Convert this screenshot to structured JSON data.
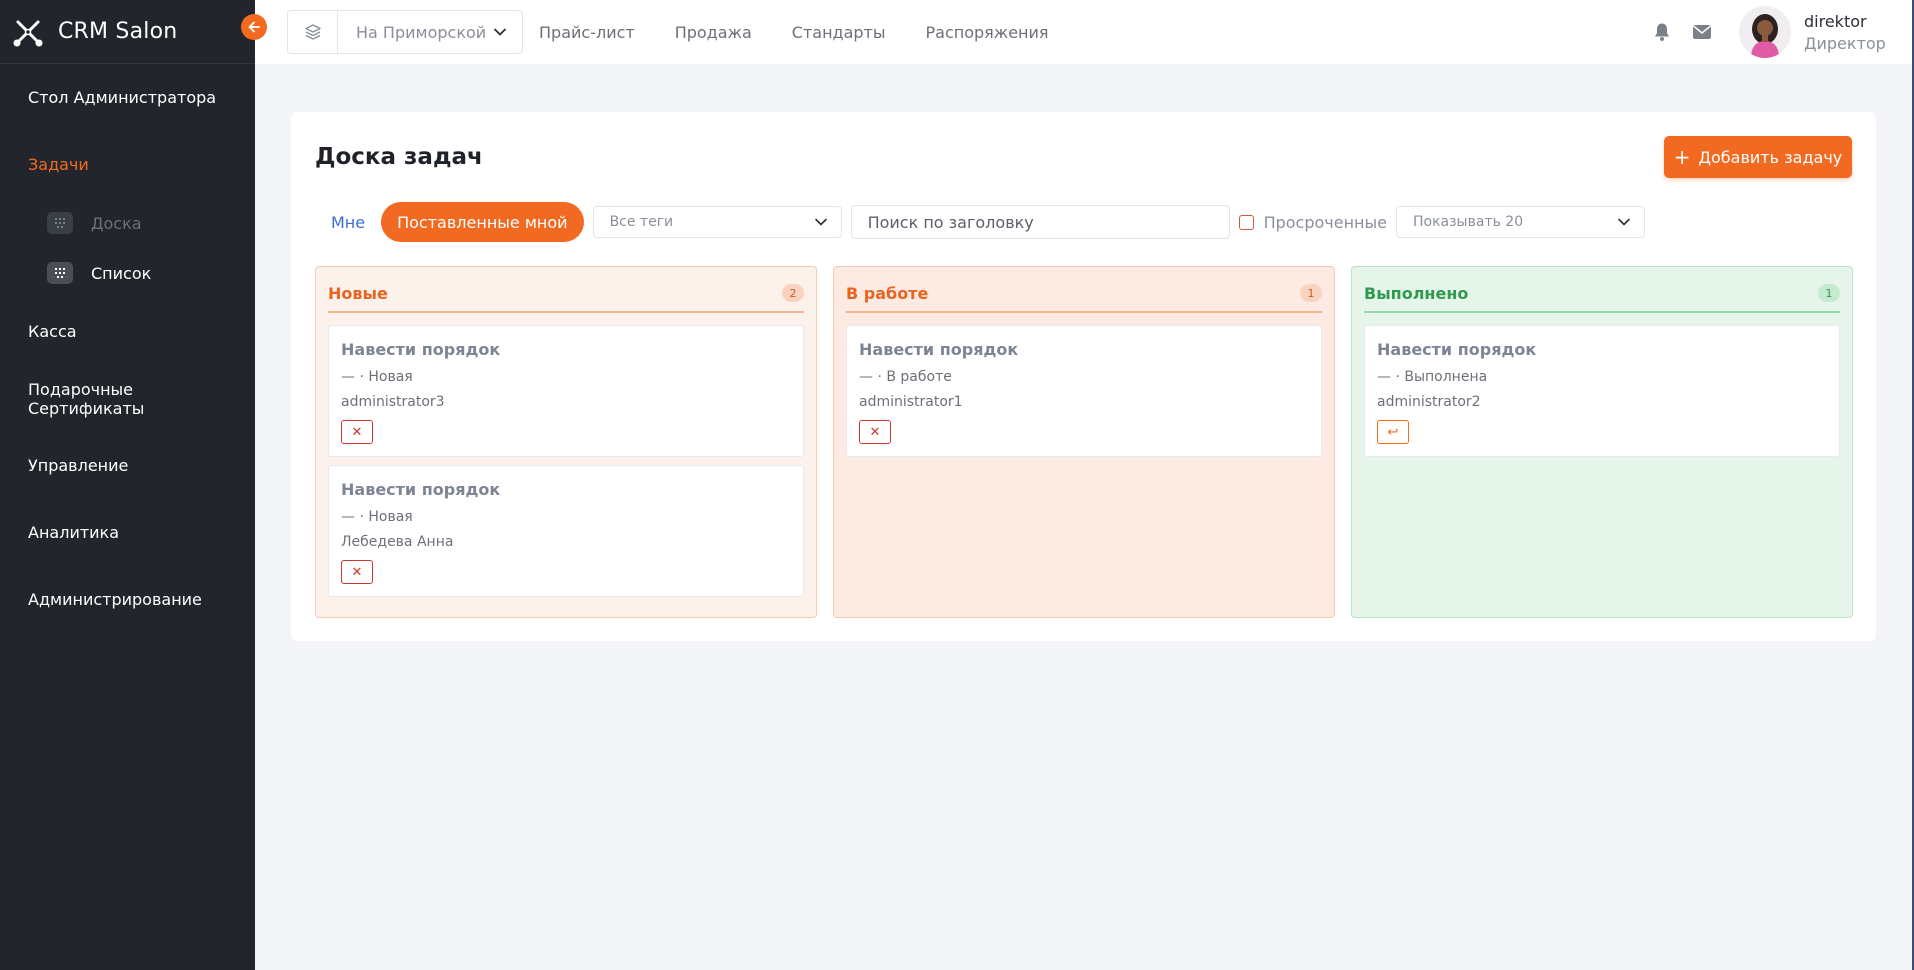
{
  "app": {
    "brand": "CRM Salon",
    "accent": "#f26a21"
  },
  "sidebar": {
    "items": [
      {
        "label": "Стол Администратора"
      },
      {
        "label": "Задачи",
        "active": true
      },
      {
        "label": "Касса"
      },
      {
        "label": "Подарочные Сертификаты"
      },
      {
        "label": "Управление"
      },
      {
        "label": "Аналитика"
      },
      {
        "label": "Администрирование"
      }
    ],
    "tasks_sub": [
      {
        "label": "Доска",
        "icon": "grid-icon"
      },
      {
        "label": "Список",
        "icon": "grid-icon"
      }
    ]
  },
  "topbar": {
    "branch": "На Приморской",
    "links": [
      "Прайс-лист",
      "Продажа",
      "Стандарты",
      "Распоряжения"
    ],
    "user": {
      "name": "direktor",
      "role": "Директор"
    }
  },
  "board": {
    "title": "Доска задач",
    "add_label": "Добавить задачу",
    "filters": {
      "mine": "Мне",
      "assigned_by_me": "Поставленные мной",
      "tags": "Все теги",
      "search_placeholder": "Поиск по заголовку",
      "overdue": "Просроченные",
      "page_size": "Показывать 20"
    },
    "columns": [
      {
        "title": "Новые",
        "count": "2",
        "tasks": [
          {
            "title": "Навести порядок",
            "status": "— · Новая",
            "user": "administrator3",
            "action": "✕"
          },
          {
            "title": "Навести порядок",
            "status": "— · Новая",
            "user": "Лебедева Анна",
            "action": "✕"
          }
        ]
      },
      {
        "title": "В работе",
        "count": "1",
        "tasks": [
          {
            "title": "Навести порядок",
            "status": "— · В работе",
            "user": "administrator1",
            "action": "✕"
          }
        ]
      },
      {
        "title": "Выполнено",
        "count": "1",
        "tasks": [
          {
            "title": "Навести порядок",
            "status": "— · Выполнена",
            "user": "administrator2",
            "action": "↩"
          }
        ]
      }
    ]
  }
}
